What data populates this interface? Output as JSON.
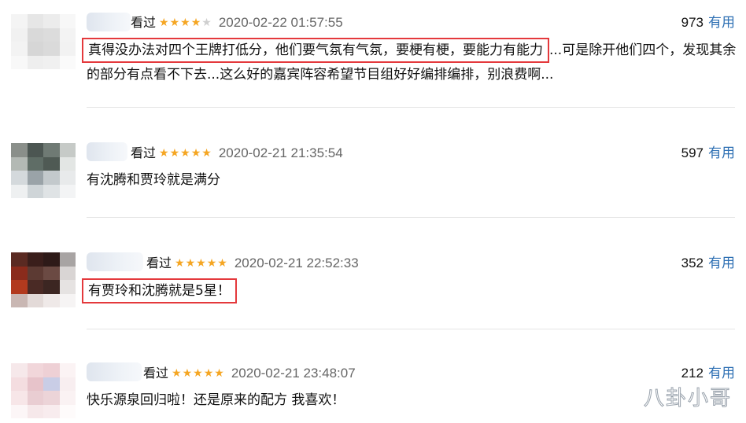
{
  "comments": [
    {
      "watched": "看过",
      "stars": [
        "on",
        "on",
        "on",
        "on",
        "off"
      ],
      "time": "2020-02-22 01:57:55",
      "votes": "973",
      "useful": "有用",
      "text_highlight": "真得没办法对四个王牌打低分，他们要气氛有气氛，要梗有梗，要能力有能力",
      "text_rest": "...可是除开他们四个，发现其余的部分有点看不下去...这么好的嘉宾阵容希望节目组好好编排编排，别浪费啊..."
    },
    {
      "watched": "看过",
      "stars": [
        "on",
        "on",
        "on",
        "on",
        "on"
      ],
      "time": "2020-02-21 21:35:54",
      "votes": "597",
      "useful": "有用",
      "text": "有沈腾和贾玲就是满分"
    },
    {
      "watched": "看过",
      "stars": [
        "on",
        "on",
        "on",
        "on",
        "on"
      ],
      "time": "2020-02-21 22:52:33",
      "votes": "352",
      "useful": "有用",
      "text_highlight": "有贾玲和沈腾就是5星！"
    },
    {
      "watched": "看过",
      "stars": [
        "on",
        "on",
        "on",
        "on",
        "on"
      ],
      "time": "2020-02-21 23:48:07",
      "votes": "212",
      "useful": "有用",
      "text": "快乐源泉回归啦！还是原来的配方 我喜欢！"
    }
  ],
  "watermark": "八卦小哥",
  "colors": {
    "star": "#f5a623",
    "useful": "#2d6fb3",
    "highlight_box": "#e4393c"
  }
}
